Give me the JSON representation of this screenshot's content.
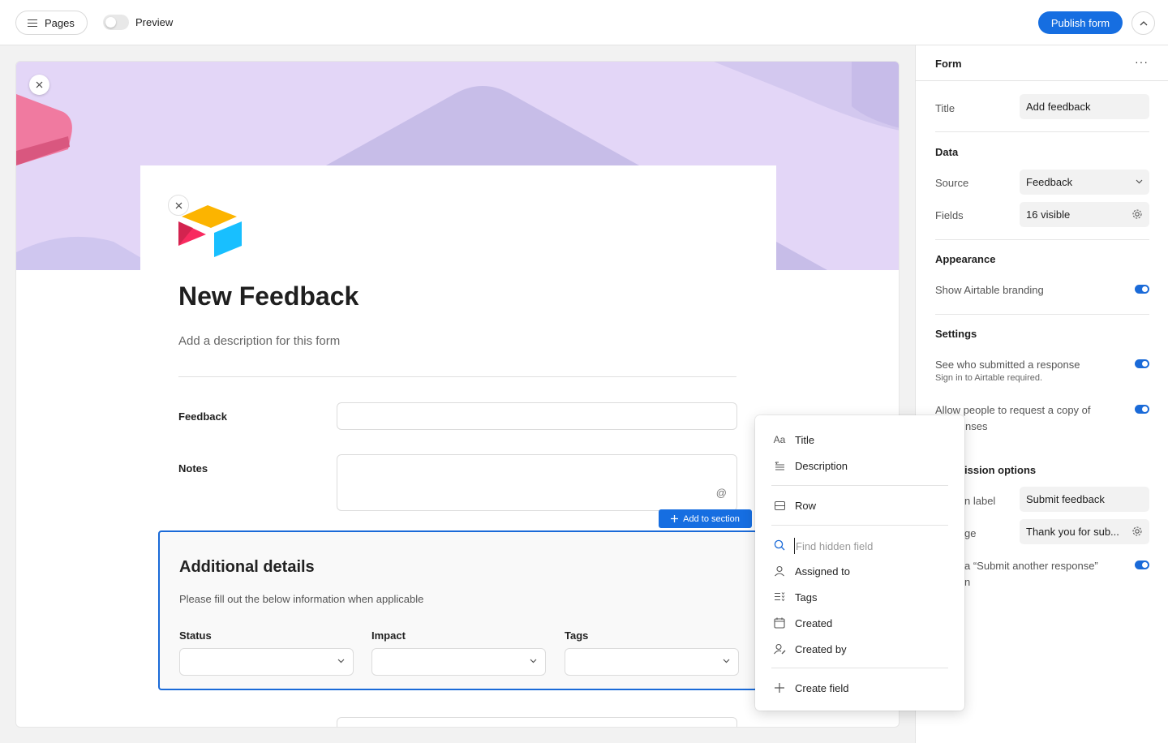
{
  "topbar": {
    "pages_label": "Pages",
    "preview_label": "Preview",
    "publish_label": "Publish form"
  },
  "form": {
    "title": "New Feedback",
    "description_placeholder": "Add a description for this form",
    "fields": [
      {
        "label": "Feedback"
      },
      {
        "label": "Notes",
        "mention_symbol": "@"
      }
    ],
    "add_to_section_label": "Add to section",
    "section": {
      "title": "Additional details",
      "subtitle": "Please fill out the below information when applicable",
      "fields": [
        {
          "label": "Status"
        },
        {
          "label": "Impact"
        },
        {
          "label": "Tags"
        }
      ]
    }
  },
  "panel": {
    "header": "Form",
    "more": "···",
    "title_label": "Title",
    "title_value": "Add feedback",
    "data_heading": "Data",
    "source_label": "Source",
    "source_value": "Feedback",
    "fields_label": "Fields",
    "fields_value": "16 visible",
    "appearance_heading": "Appearance",
    "branding_label": "Show Airtable branding",
    "settings_heading": "Settings",
    "see_who_label": "See who submitted a response",
    "see_who_sub": "Sign in to Airtable required.",
    "allow_copy_label": "Allow people to request a copy of",
    "allow_copy_label_2": "nses",
    "submission_heading": "ission options",
    "button_label_label": "n label",
    "button_label_value": "Submit feedback",
    "message_label": "ge",
    "message_value": "Thank you for sub...",
    "another_label": "a “Submit another response”",
    "another_label_2": "n"
  },
  "menu": {
    "items_top": [
      {
        "icon": "Aa",
        "label": "Title"
      },
      {
        "icon": "description-icon",
        "label": "Description"
      }
    ],
    "row_item": {
      "label": "Row"
    },
    "search_placeholder": "Find hidden field",
    "hidden_fields": [
      {
        "label": "Assigned to"
      },
      {
        "label": "Tags"
      },
      {
        "label": "Created"
      },
      {
        "label": "Created by"
      }
    ],
    "create_label": "Create field"
  },
  "colors": {
    "accent": "#166ee1",
    "cover": "#e3d6f7"
  }
}
